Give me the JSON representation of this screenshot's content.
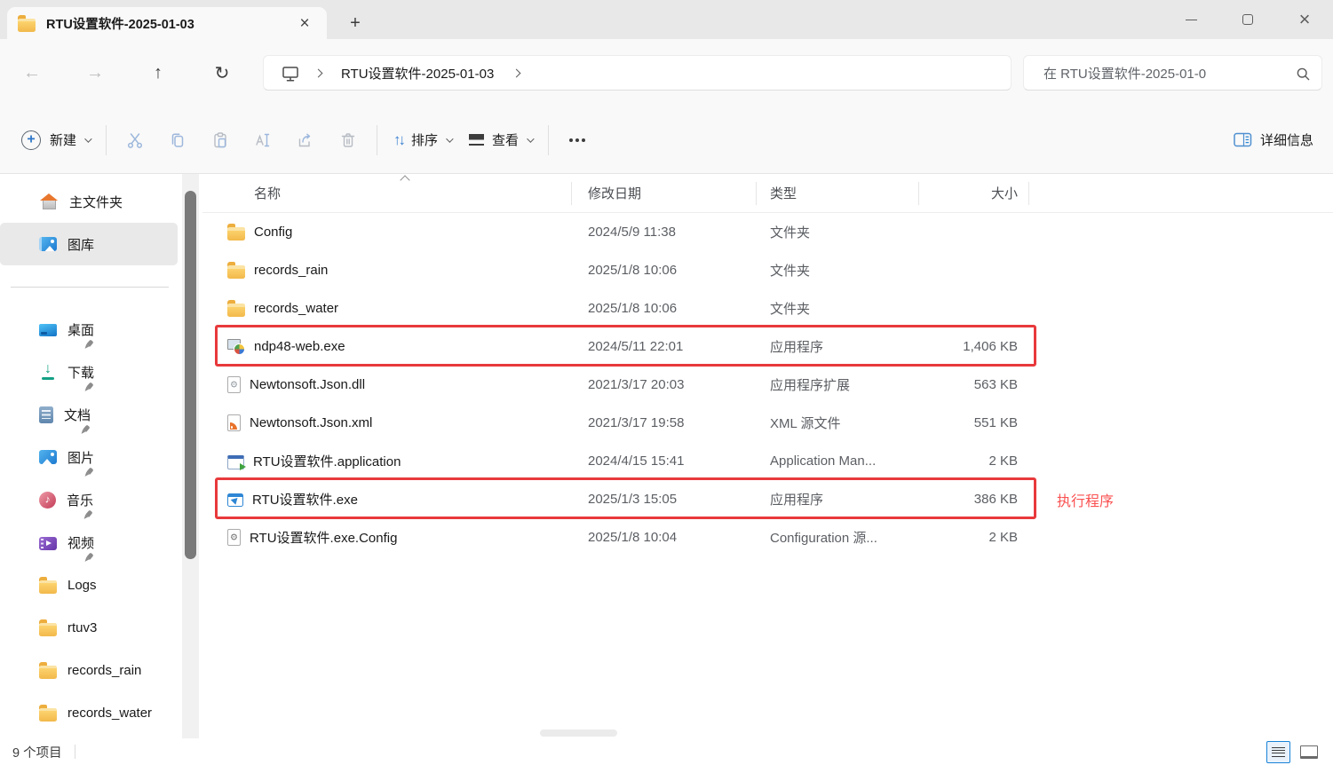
{
  "colors": {
    "accent_blue": "#1883D7",
    "highlight_box_red": "#E8393B",
    "annotation_red": "#FA5151",
    "tabbar_bg": "#E8E8E8",
    "chrome_bg": "#F9F9F9"
  },
  "icons": {
    "back": "←",
    "forward": "→",
    "up": "↑",
    "refresh": "↻",
    "sort": "↑↓",
    "tab": "folder-icon",
    "address_device": "this-pc-monitor-icon",
    "search": "magnifier-icon",
    "new": "plus-circle-icon",
    "details_pane": "details-panel-icon"
  },
  "tab_bar": {
    "active_tab_title": "RTU设置软件-2025-01-03"
  },
  "address_bar": {
    "path": "RTU设置软件-2025-01-03"
  },
  "search": {
    "placeholder": "在 RTU设置软件-2025-01-0"
  },
  "toolbar": {
    "new_label": "新建",
    "sort_label": "排序",
    "view_label": "查看",
    "details_label": "详细信息"
  },
  "sidebar": {
    "items": [
      {
        "key": "home",
        "label": "主文件夹",
        "icon": "home",
        "pinned": false,
        "selected": false
      },
      {
        "key": "gallery",
        "label": "图库",
        "icon": "gallery",
        "pinned": false,
        "selected": true
      },
      {
        "type": "divider"
      },
      {
        "key": "desktop",
        "label": "桌面",
        "icon": "desktop",
        "pinned": true,
        "selected": false
      },
      {
        "key": "downloads",
        "label": "下载",
        "icon": "download",
        "pinned": true,
        "selected": false
      },
      {
        "key": "documents",
        "label": "文档",
        "icon": "documents",
        "pinned": true,
        "selected": false
      },
      {
        "key": "pictures",
        "label": "图片",
        "icon": "pictures",
        "pinned": true,
        "selected": false
      },
      {
        "key": "music",
        "label": "音乐",
        "icon": "music",
        "pinned": true,
        "selected": false
      },
      {
        "key": "videos",
        "label": "视频",
        "icon": "videos",
        "pinned": true,
        "selected": false
      },
      {
        "key": "logs",
        "label": "Logs",
        "icon": "folder",
        "pinned": false,
        "selected": false
      },
      {
        "key": "rtuv3",
        "label": "rtuv3",
        "icon": "folder",
        "pinned": false,
        "selected": false
      },
      {
        "key": "records-rain",
        "label": "records_rain",
        "icon": "folder",
        "pinned": false,
        "selected": false
      },
      {
        "key": "records-water",
        "label": "records_water",
        "icon": "folder",
        "pinned": false,
        "selected": false
      }
    ]
  },
  "columns": [
    {
      "key": "name",
      "label": "名称",
      "sorted": "asc"
    },
    {
      "key": "date",
      "label": "修改日期",
      "sorted": null
    },
    {
      "key": "type",
      "label": "类型",
      "sorted": null
    },
    {
      "key": "size",
      "label": "大小",
      "sorted": null
    }
  ],
  "files": [
    {
      "name": "Config",
      "icon": "folder",
      "date": "2024/5/9 11:38",
      "type": "文件夹",
      "size": "",
      "highlighted": false
    },
    {
      "name": "records_rain",
      "icon": "folder",
      "date": "2025/1/8 10:06",
      "type": "文件夹",
      "size": "",
      "highlighted": false
    },
    {
      "name": "records_water",
      "icon": "folder",
      "date": "2025/1/8 10:06",
      "type": "文件夹",
      "size": "",
      "highlighted": false
    },
    {
      "name": "ndp48-web.exe",
      "icon": "installer",
      "date": "2024/5/11 22:01",
      "type": "应用程序",
      "size": "1,406 KB",
      "highlighted": true
    },
    {
      "name": "Newtonsoft.Json.dll",
      "icon": "dll",
      "date": "2021/3/17 20:03",
      "type": "应用程序扩展",
      "size": "563 KB",
      "highlighted": false
    },
    {
      "name": "Newtonsoft.Json.xml",
      "icon": "xml",
      "date": "2021/3/17 19:58",
      "type": "XML 源文件",
      "size": "551 KB",
      "highlighted": false
    },
    {
      "name": "RTU设置软件.application",
      "icon": "manifest",
      "date": "2024/4/15 15:41",
      "type": "Application Man...",
      "size": "2 KB",
      "highlighted": false
    },
    {
      "name": "RTU设置软件.exe",
      "icon": "exe",
      "date": "2025/1/3 15:05",
      "type": "应用程序",
      "size": "386 KB",
      "highlighted": true,
      "annotated": true
    },
    {
      "name": "RTU设置软件.exe.Config",
      "icon": "config",
      "date": "2025/1/8 10:04",
      "type": "Configuration 源...",
      "size": "2 KB",
      "highlighted": false
    }
  ],
  "annotation": {
    "text": "执行程序"
  },
  "status_bar": {
    "items_count": "9 个项目"
  }
}
